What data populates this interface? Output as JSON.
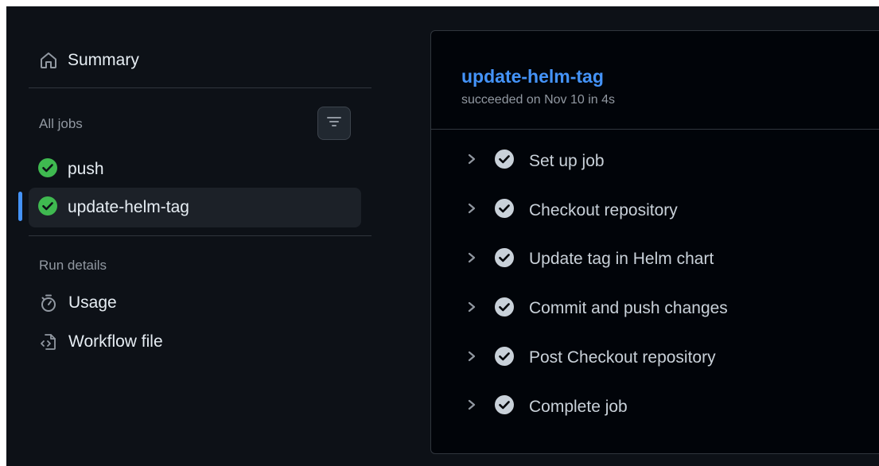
{
  "sidebar": {
    "summary_label": "Summary",
    "all_jobs_title": "All jobs",
    "jobs": [
      {
        "label": "push",
        "status": "success",
        "active": false
      },
      {
        "label": "update-helm-tag",
        "status": "success",
        "active": true
      }
    ],
    "run_details_title": "Run details",
    "details": [
      {
        "label": "Usage",
        "icon": "stopwatch-icon"
      },
      {
        "label": "Workflow file",
        "icon": "file-code-icon"
      }
    ]
  },
  "job": {
    "title": "update-helm-tag",
    "subtitle": "succeeded on Nov 10 in 4s",
    "steps": [
      {
        "label": "Set up job"
      },
      {
        "label": "Checkout repository"
      },
      {
        "label": "Update tag in Helm chart"
      },
      {
        "label": "Commit and push changes"
      },
      {
        "label": "Post Checkout repository"
      },
      {
        "label": "Complete job"
      }
    ]
  },
  "colors": {
    "background": "#0d1117",
    "panel": "#010409",
    "accent_blue": "#4493f8",
    "success_green": "#3fb950",
    "step_check_gray": "#c9d1d9"
  }
}
